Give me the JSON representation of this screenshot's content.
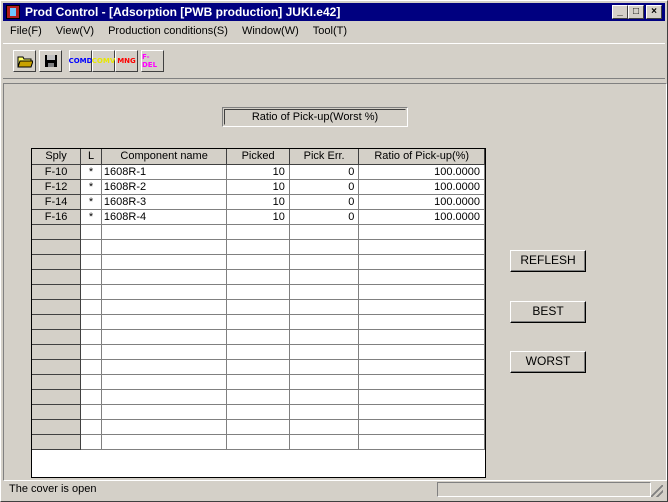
{
  "window": {
    "title": "Prod Control - [Adsorption [PWB production] JUKI.e42]",
    "min_label": "_",
    "max_label": "□",
    "close_label": "×"
  },
  "menu": [
    "File(F)",
    "View(V)",
    "Production conditions(S)",
    "Window(W)",
    "Tool(T)"
  ],
  "toolbar": {
    "buttons": [
      {
        "name": "open-folder",
        "label": "📂",
        "color": "#000000"
      },
      {
        "name": "save",
        "label": "💾",
        "color": "#000000"
      },
      {
        "name": "comd",
        "label": "COMD",
        "color": "#0000ff"
      },
      {
        "name": "comv",
        "label": "COMV",
        "color": "#ffff00"
      },
      {
        "name": "mng",
        "label": "MNG",
        "color": "#ff0000"
      },
      {
        "name": "fdel",
        "label": "F-DEL",
        "color": "#ff00ff"
      }
    ]
  },
  "panel": {
    "ratio_label": "Ratio of Pick-up(Worst %)"
  },
  "grid": {
    "headers": [
      "Sply",
      "L",
      "Component name",
      "Picked",
      "Pick Err.",
      "Ratio of Pick-up(%)"
    ],
    "rows": [
      {
        "sply": "F-10",
        "L": "*",
        "name": "1608R-1",
        "picked": "10",
        "err": "0",
        "ratio": "100.0000"
      },
      {
        "sply": "F-12",
        "L": "*",
        "name": "1608R-2",
        "picked": "10",
        "err": "0",
        "ratio": "100.0000"
      },
      {
        "sply": "F-14",
        "L": "*",
        "name": "1608R-3",
        "picked": "10",
        "err": "0",
        "ratio": "100.0000"
      },
      {
        "sply": "F-16",
        "L": "*",
        "name": "1608R-4",
        "picked": "10",
        "err": "0",
        "ratio": "100.0000"
      }
    ],
    "empty_rows": 15
  },
  "buttons": {
    "refresh": "REFLESH",
    "best": "BEST",
    "worst": "WORST"
  },
  "status": {
    "text": "The cover is open"
  }
}
